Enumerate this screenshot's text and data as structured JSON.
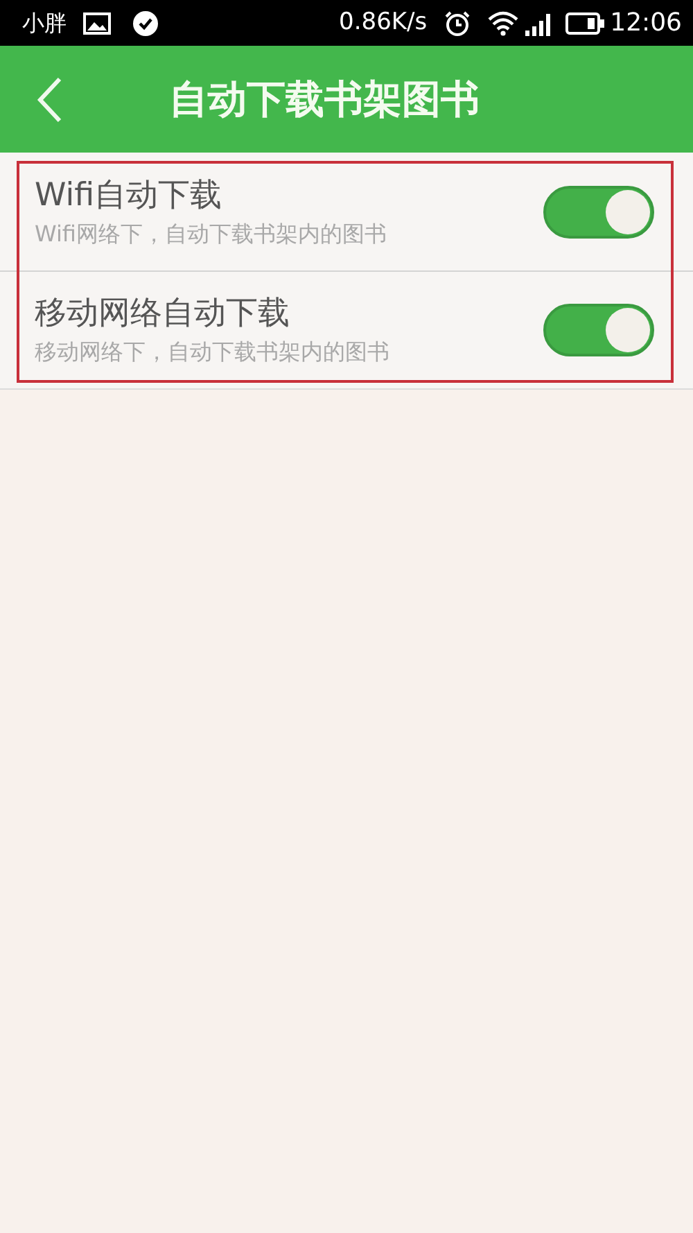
{
  "status_bar": {
    "carrier": "小胖",
    "speed": "0.86K/s",
    "time": "12:06"
  },
  "header": {
    "title": "自动下载书架图书"
  },
  "settings": [
    {
      "title": "Wifi自动下载",
      "subtitle": "Wifi网络下，自动下载书架内的图书",
      "on": true
    },
    {
      "title": "移动网络自动下载",
      "subtitle": "移动网络下，自动下载书架内的图书",
      "on": true
    }
  ]
}
